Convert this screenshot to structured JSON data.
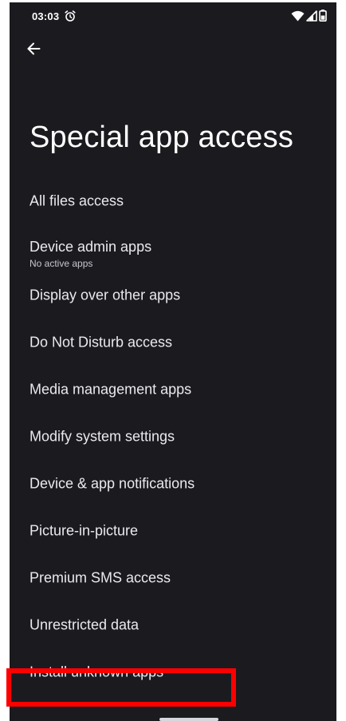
{
  "status_bar": {
    "time": "03:03",
    "alarm_icon": "alarm-clock-icon",
    "wifi_icon": "wifi-icon",
    "signal_icon": "cell-signal-icon",
    "battery_icon": "battery-icon"
  },
  "header": {
    "back_icon": "arrow-back-icon",
    "title": "Special app access"
  },
  "settings": {
    "items": [
      {
        "title": "All files access",
        "summary": ""
      },
      {
        "title": "Device admin apps",
        "summary": "No active apps"
      },
      {
        "title": "Display over other apps",
        "summary": ""
      },
      {
        "title": "Do Not Disturb access",
        "summary": ""
      },
      {
        "title": "Media management apps",
        "summary": ""
      },
      {
        "title": "Modify system settings",
        "summary": ""
      },
      {
        "title": "Device & app notifications",
        "summary": ""
      },
      {
        "title": "Picture-in-picture",
        "summary": ""
      },
      {
        "title": "Premium SMS access",
        "summary": ""
      },
      {
        "title": "Unrestricted data",
        "summary": ""
      },
      {
        "title": "Install unknown apps",
        "summary": ""
      }
    ]
  },
  "colors": {
    "background": "#1b1b1f",
    "text_primary": "#e9e9ee",
    "text_secondary": "#c5c6d0",
    "highlight": "#ff0000"
  }
}
